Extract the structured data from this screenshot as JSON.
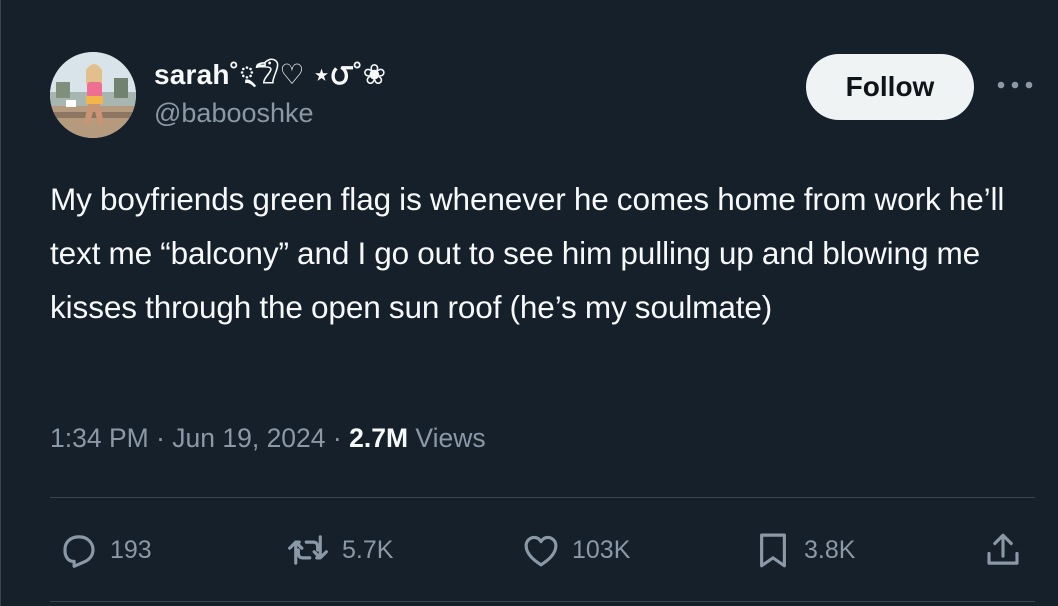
{
  "user": {
    "display_name": "sarah",
    "name_decor": "˚྄𓅿♡ ⋆౮˚❀",
    "handle": "@babooshke"
  },
  "follow_label": "Follow",
  "tweet": {
    "text": "My boyfriends green flag is whenever he comes home from work he’ll text me “balcony” and I go out to see him pulling up and blowing me kisses through the open sun roof (he’s my soulmate)"
  },
  "meta": {
    "time": "1:34 PM",
    "separator": "·",
    "date": "Jun 19, 2024",
    "views_count": "2.7M",
    "views_label": "Views"
  },
  "actions": {
    "replies": "193",
    "reposts": "5.7K",
    "likes": "103K",
    "bookmarks": "3.8K"
  },
  "icons": [
    "reply-icon",
    "repost-icon",
    "like-icon",
    "bookmark-icon",
    "share-icon",
    "more-icon"
  ],
  "colors": {
    "background": "#15202b",
    "text": "#f7f9f9",
    "secondary": "#8b98a5",
    "border": "#38444d",
    "follow_bg": "#eff3f4"
  }
}
